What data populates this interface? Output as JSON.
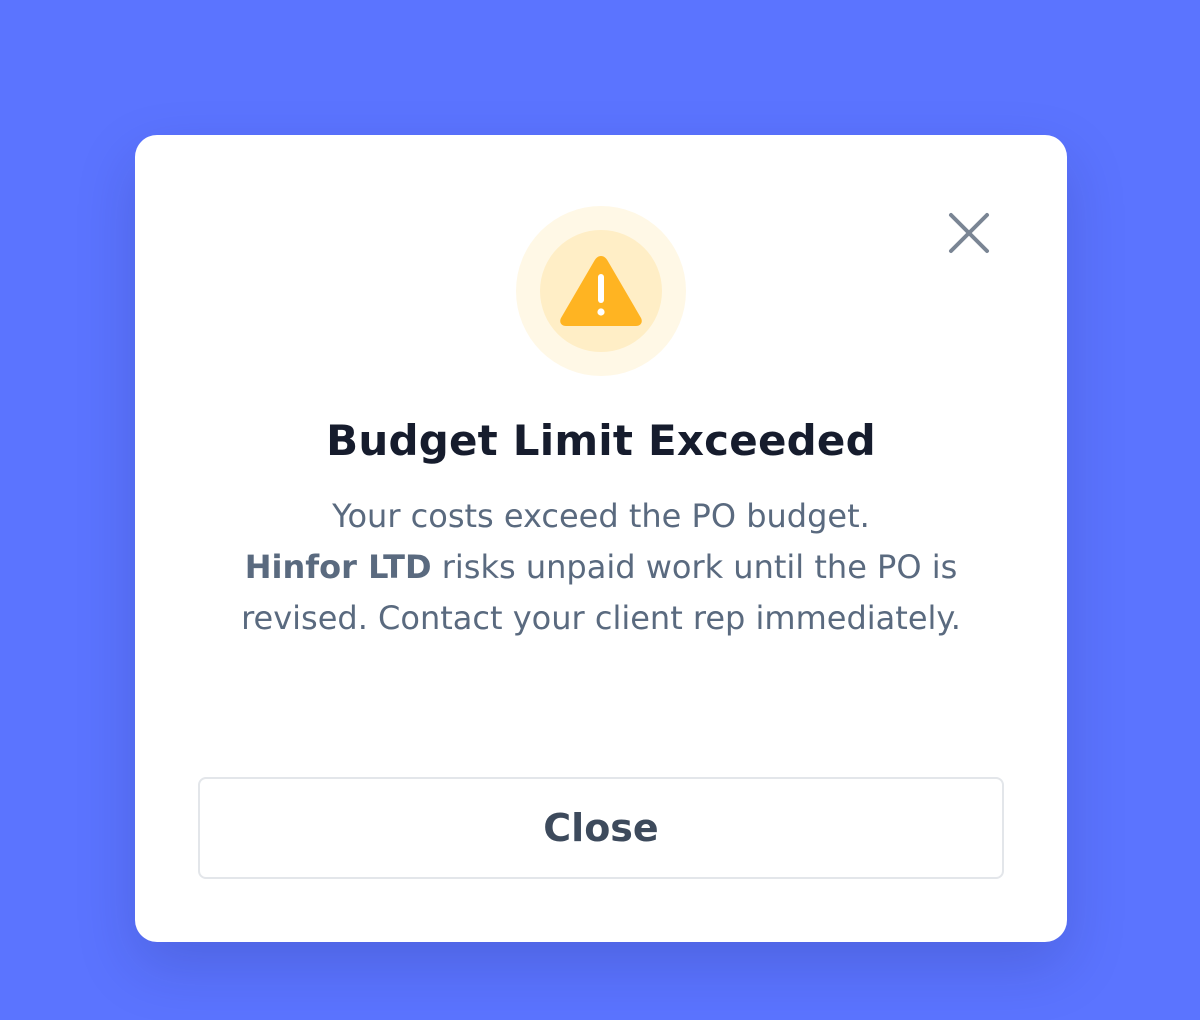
{
  "dialog": {
    "title": "Budget Limit Exceeded",
    "message_line1": "Your costs exceed the PO budget.",
    "company_name": "Hinfor LTD",
    "message_rest": " risks unpaid work until the PO is revised. Contact your client rep immediately.",
    "close_button_label": "Close",
    "icons": {
      "dismiss": "close-icon",
      "alert": "warning-triangle-icon"
    }
  },
  "colors": {
    "backdrop": "#5b74ff",
    "warning": "#ffb422",
    "warning_ring_outer": "#fff8e6",
    "warning_ring_inner": "#ffeec6"
  }
}
